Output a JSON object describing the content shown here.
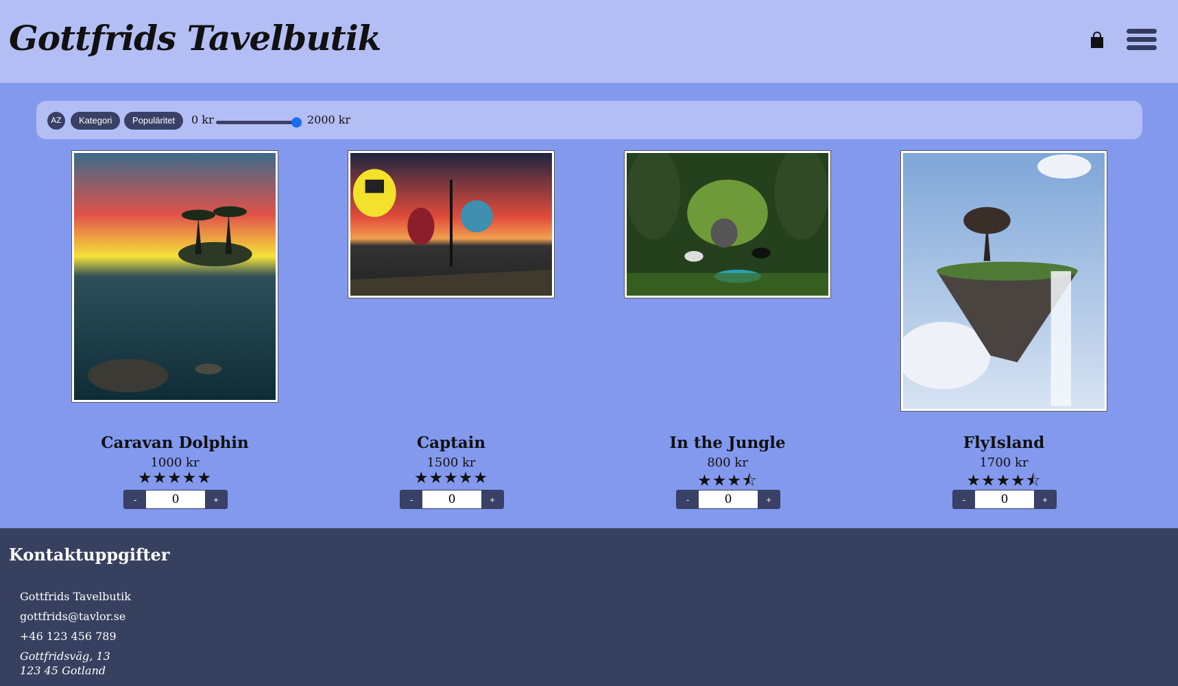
{
  "header": {
    "logo": "Gottfrids Tavelbutik",
    "cart_icon": "shopping-bag-icon",
    "menu_icon": "hamburger-menu-icon"
  },
  "filters": {
    "sort_icon_label": "AZ",
    "category_label": "Kategori",
    "popularity_label": "Populäritet",
    "price_min": "0 kr",
    "price_max": "2000 kr",
    "slider_value_fraction": 1.0
  },
  "products": [
    {
      "title": "Caravan Dolphin",
      "price": "1000 kr",
      "rating": 5,
      "stars": "★★★★★",
      "quantity": "0",
      "minus": "-",
      "plus": "+"
    },
    {
      "title": "Captain",
      "price": "1500 kr",
      "rating": 5,
      "stars": "★★★★★",
      "quantity": "0",
      "minus": "-",
      "plus": "+"
    },
    {
      "title": "In the Jungle",
      "price": "800 kr",
      "rating": 3.5,
      "stars": "★★★⯪",
      "quantity": "0",
      "minus": "-",
      "plus": "+"
    },
    {
      "title": "FlyIsland",
      "price": "1700 kr",
      "rating": 4.5,
      "stars": "★★★★⯪",
      "quantity": "0",
      "minus": "-",
      "plus": "+"
    }
  ],
  "footer": {
    "heading": "Kontaktuppgifter",
    "company": "Gottfrids Tavelbutik",
    "email": "gottfrids@tavlor.se",
    "phone": "+46 123 456 789",
    "address_line1": "Gottfridsväg, 13",
    "address_line2": "123 45 Gotland"
  },
  "colors": {
    "header_bg": "#b3bef5",
    "page_bg": "#8399ee",
    "dark_accent": "#3a4166",
    "footer_bg": "#37405f",
    "slider_thumb": "#1a6cf0"
  }
}
